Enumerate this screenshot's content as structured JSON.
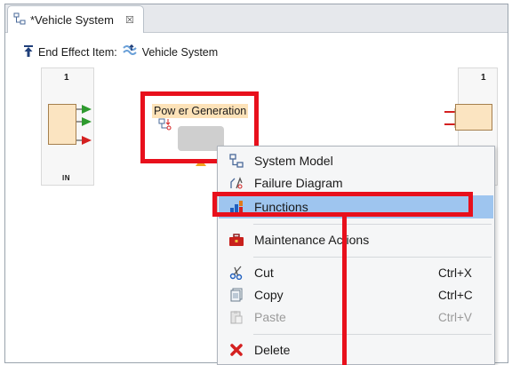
{
  "tab": {
    "title": "*Vehicle System",
    "close": "☒"
  },
  "end_effect": {
    "label": "End Effect Item:",
    "item": "Vehicle System"
  },
  "left_block": {
    "number": "1",
    "port_label": "IN"
  },
  "right_block": {
    "number": "1",
    "port_label": "UT"
  },
  "node": {
    "label": "Pow er Generation"
  },
  "menu": {
    "items": [
      {
        "label": "System Model",
        "shortcut": ""
      },
      {
        "label": "Failure Diagram",
        "shortcut": ""
      },
      {
        "label": "Functions",
        "shortcut": ""
      },
      {
        "label": "Maintenance Actions",
        "shortcut": ""
      },
      {
        "label": "Cut",
        "shortcut": "Ctrl+X"
      },
      {
        "label": "Copy",
        "shortcut": "Ctrl+C"
      },
      {
        "label": "Paste",
        "shortcut": "Ctrl+V"
      },
      {
        "label": "Delete",
        "shortcut": ""
      }
    ]
  },
  "colors": {
    "highlight_red": "#e8101c",
    "menu_selection": "#9ec5ef",
    "node_label_bg": "#fde2b8"
  }
}
